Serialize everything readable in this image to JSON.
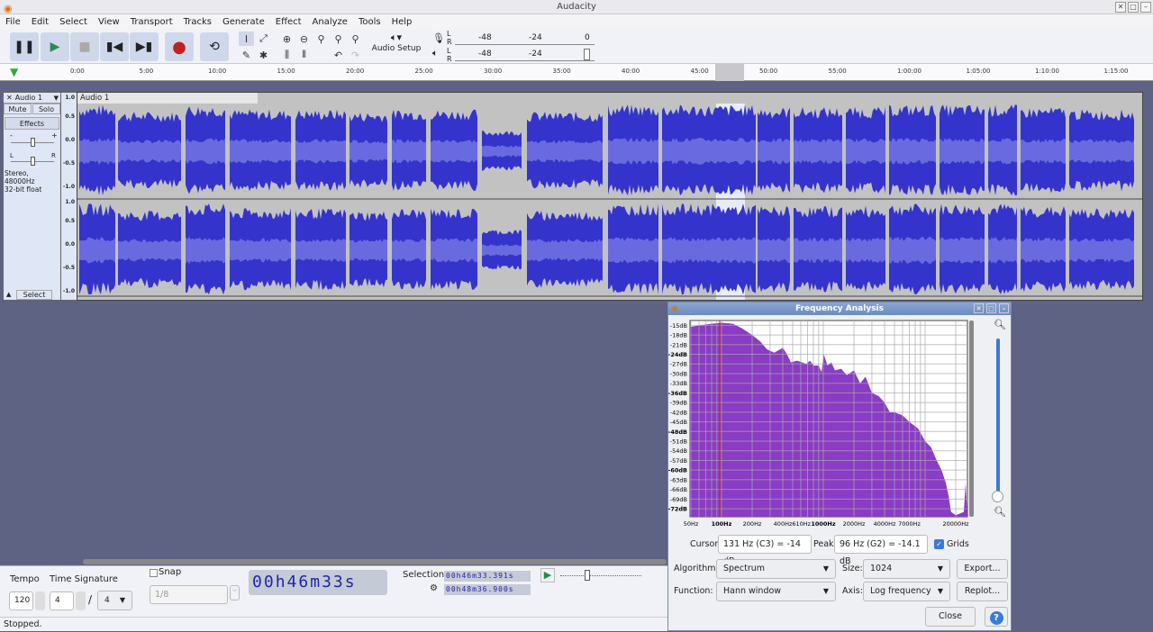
{
  "window": {
    "title": "Audacity"
  },
  "menu": [
    "File",
    "Edit",
    "Select",
    "View",
    "Transport",
    "Tracks",
    "Generate",
    "Effect",
    "Analyze",
    "Tools",
    "Help"
  ],
  "toolbar": {
    "audio_setup": "Audio Setup",
    "meter_record": [
      "-48",
      " ",
      "-24",
      "0"
    ],
    "meter_play": [
      "-48",
      "-24"
    ],
    "lr": [
      "L",
      "R"
    ]
  },
  "ruler": {
    "ticks": [
      "0:00",
      "5:00",
      "10:00",
      "15:00",
      "20:00",
      "25:00",
      "30:00",
      "35:00",
      "40:00",
      "45:00",
      "50:00",
      "55:00",
      "1:00:00",
      "1:05:00",
      "1:10:00",
      "1:15:00"
    ]
  },
  "track": {
    "name": "Audio 1",
    "clip_name": "Audio 1",
    "mute": "Mute",
    "solo": "Solo",
    "effects": "Effects",
    "gain_minus": "-",
    "gain_plus": "+",
    "pan_l": "L",
    "pan_r": "R",
    "info1": "Stereo, 48000Hz",
    "info2": "32-bit float",
    "select": "Select",
    "scale": [
      "1.0",
      "0.5",
      "0.0",
      "-0.5",
      "-1.0"
    ]
  },
  "bottom": {
    "tempo_label": "Tempo",
    "tempo": "120",
    "timesig_label": "Time Signature",
    "ts_num": "4",
    "ts_den": "4",
    "snap_label": "Snap",
    "snap_value": "1/8",
    "time_digits": [
      "0",
      "0",
      "h",
      "4",
      "6",
      "m",
      "3",
      "3",
      "s"
    ],
    "selection_label": "Selection",
    "sel_start": "00h46m33.391s",
    "sel_end": "00h48m36.900s"
  },
  "status": "Stopped.",
  "dialog": {
    "title": "Frequency Analysis",
    "cursor_label": "Cursor:",
    "cursor_value": "131 Hz (C3) = -14 dB",
    "peak_label": "Peak:",
    "peak_value": "96 Hz (G2) = -14.1 dB",
    "grids_label": "Grids",
    "grids_checked": true,
    "algorithm_label": "Algorithm:",
    "algorithm": "Spectrum",
    "size_label": "Size:",
    "size": "1024",
    "function_label": "Function:",
    "function": "Hann window",
    "axis_label": "Axis:",
    "axis": "Log frequency",
    "export": "Export...",
    "replot": "Replot...",
    "close": "Close",
    "help": "?",
    "db_labels": [
      "-15dB",
      "-18dB",
      "-21dB",
      "-24dB",
      "-27dB",
      "-30dB",
      "-33dB",
      "-36dB",
      "-39dB",
      "-42dB",
      "-45dB",
      "-48dB",
      "-51dB",
      "-54dB",
      "-57dB",
      "-60dB",
      "-63dB",
      "-66dB",
      "-69dB",
      "-72dB"
    ],
    "freq_labels": [
      [
        "50Hz",
        50
      ],
      [
        "100Hz",
        100
      ],
      [
        "200Hz",
        200
      ],
      [
        "400Hz",
        400
      ],
      [
        "610Hz",
        610
      ],
      [
        "1000Hz",
        1000
      ],
      [
        "2000Hz",
        2000
      ],
      [
        "4000Hz",
        4000
      ],
      [
        "7000Hz",
        7000
      ],
      [
        "20000Hz",
        20000
      ]
    ],
    "spectrum_color": "#8a3cc4",
    "spectrum": [
      [
        49,
        -15.5
      ],
      [
        60,
        -15
      ],
      [
        80,
        -14.5
      ],
      [
        100,
        -14.2
      ],
      [
        130,
        -14.5
      ],
      [
        160,
        -16
      ],
      [
        200,
        -18
      ],
      [
        240,
        -20
      ],
      [
        280,
        -22.5
      ],
      [
        330,
        -23.5
      ],
      [
        400,
        -22
      ],
      [
        440,
        -24
      ],
      [
        480,
        -26.5
      ],
      [
        550,
        -26
      ],
      [
        620,
        -26.5
      ],
      [
        680,
        -27
      ],
      [
        740,
        -26
      ],
      [
        800,
        -27.5
      ],
      [
        900,
        -27.5
      ],
      [
        960,
        -29.5
      ],
      [
        1010,
        -24
      ],
      [
        1100,
        -27.5
      ],
      [
        1200,
        -26.5
      ],
      [
        1300,
        -29
      ],
      [
        1500,
        -28.5
      ],
      [
        1700,
        -30.5
      ],
      [
        2000,
        -29
      ],
      [
        2300,
        -33
      ],
      [
        2600,
        -31
      ],
      [
        3000,
        -36
      ],
      [
        3500,
        -37
      ],
      [
        4000,
        -39
      ],
      [
        4500,
        -42
      ],
      [
        5000,
        -42
      ],
      [
        6000,
        -43
      ],
      [
        7000,
        -45
      ],
      [
        8500,
        -47
      ],
      [
        10000,
        -51
      ],
      [
        11500,
        -53
      ],
      [
        13000,
        -57
      ],
      [
        14500,
        -60
      ],
      [
        16000,
        -64
      ],
      [
        17000,
        -68
      ],
      [
        18000,
        -73
      ],
      [
        20000,
        -74
      ],
      [
        24000,
        -73
      ],
      [
        25000,
        -64
      ]
    ]
  }
}
